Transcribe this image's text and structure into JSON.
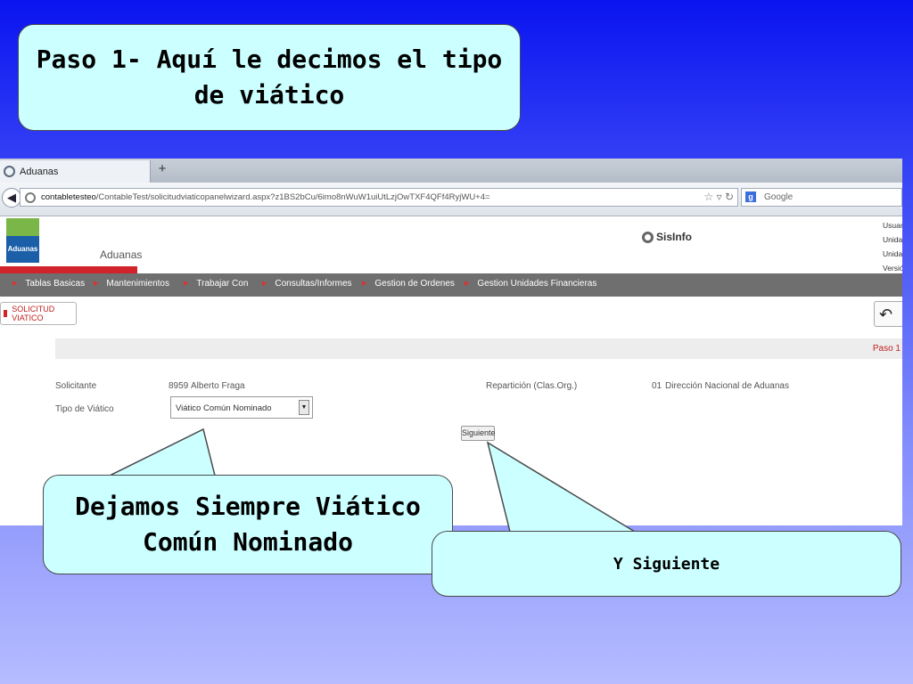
{
  "callouts": {
    "step1": "Paso 1- Aquí le decimos el tipo de viático",
    "nominado": "Dejamos Siempre Viático Común Nominado",
    "siguiente": "Y Siguiente"
  },
  "browser": {
    "tab_title": "Aduanas",
    "new_tab": "+",
    "url_host": "contabletesteo",
    "url_path": "/ContableTest/solicitudviaticopanelwizard.aspx?z1BS2bCu/6imo8nWuW1uiUtLzjOwTXF4QFf4RyjWU+4=",
    "search_placeholder": "Google"
  },
  "app": {
    "logo_text": "Aduanas",
    "title": "Aduanas",
    "brand": "SisInfo",
    "user_info": [
      "Usuario",
      "Unidad",
      "Unidad",
      "Versión"
    ],
    "menu": [
      "Tablas Basicas",
      "Mantenimientos",
      "Trabajar Con",
      "Consultas/Informes",
      "Gestion de Ordenes",
      "Gestion Unidades Financieras"
    ],
    "page_tab": "SOLICITUD VIATICO",
    "step_label": "Paso 1"
  },
  "form": {
    "solicitante_label": "Solicitante",
    "solicitante_code": "8959",
    "solicitante_name": "Alberto Fraga",
    "tipo_label": "Tipo de Viático",
    "tipo_value": "Viático Común Nominado",
    "reparticion_label": "Repartición (Clas.Org.)",
    "reparticion_code": "01",
    "reparticion_name": "Dirección Nacional de Aduanas",
    "next_button": "Siguiente"
  },
  "colors": {
    "callout_fill": "#ccffff",
    "menu_bar": "#6f6f6f",
    "accent_red": "#d0242a",
    "background_top": "#0a14f0"
  }
}
